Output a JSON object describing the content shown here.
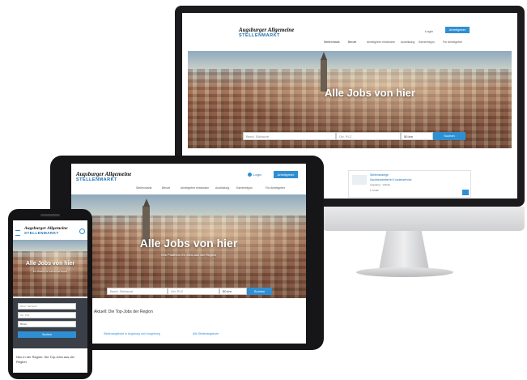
{
  "brand": {
    "name_line1": "Augsburger Allgemeine",
    "name_line2": "STELLENMARKT"
  },
  "hero": {
    "headline_desktop": "Alle Jobs von hier",
    "headline_tablet": "Alle Jobs von hier",
    "headline_phone": "Alle Jobs von hier",
    "subline": "Ihre Plattform für Jobs aus der Region"
  },
  "desktop": {
    "nav": {
      "login": "Login",
      "employer_button": "Arbeitgeber",
      "links": [
        "Stellenmarkt",
        "Berufe",
        "Arbeitgeber entdecken",
        "Ausbildung",
        "Karrieretipps",
        "Für Arbeitgeber"
      ]
    },
    "search": {
      "keyword_placeholder": "Beruf, Stichwort",
      "location_placeholder": "Ort, PLZ",
      "radius_value": "50 km",
      "button": "Suchen"
    },
    "card": {
      "company": "Stellenanzeige",
      "title": "Sachbearbeiter/in Kundenservice",
      "meta": "Augsburg · Vollzeit",
      "footer": "1 Treffer"
    }
  },
  "tablet": {
    "nav": {
      "login": "Login",
      "employer_button": "Arbeitgeber",
      "links": [
        "Stellenmarkt",
        "Berufe",
        "Arbeitgeber entdecken",
        "Ausbildung",
        "Karrieretipps",
        "Für Arbeitgeber"
      ]
    },
    "search": {
      "keyword_placeholder": "Beruf, Stichwort",
      "location_placeholder": "Ort, PLZ",
      "radius_value": "50 km",
      "button": "Suchen"
    },
    "below_hero_text": "Aktuell: Die Top-Jobs der Region",
    "links": [
      "Stellenangebote in Augsburg und Umgebung",
      "Alle Stellenangebote"
    ]
  },
  "phone": {
    "fields": [
      "Beruf, Stichwort",
      "Ort, PLZ",
      "50 km"
    ],
    "button": "Suchen",
    "teaser": "Neu in der Region: Die Top-Jobs aus der Region"
  },
  "colors": {
    "accent": "#2f8fd3",
    "brand_blue": "#1b6fb3"
  }
}
